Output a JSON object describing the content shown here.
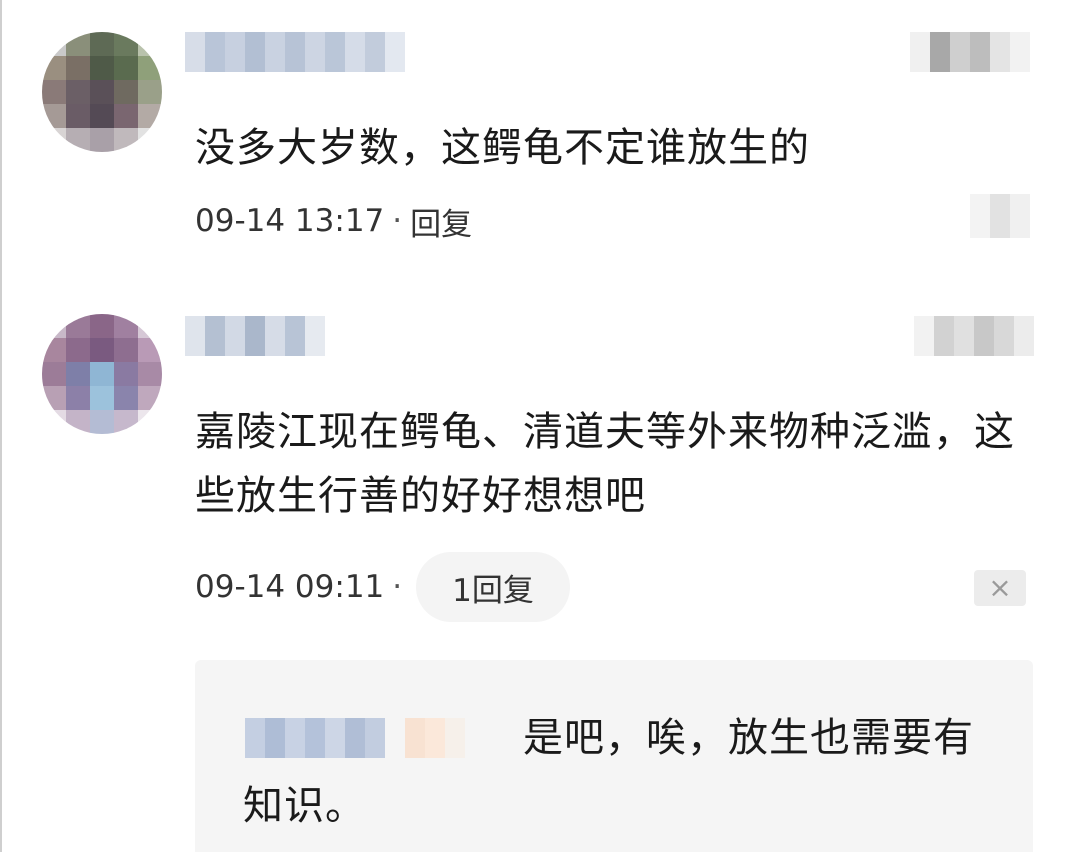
{
  "comments": [
    {
      "text": "没多大岁数，这鳄龟不定谁放生的",
      "timestamp": "09-14 13:17",
      "separator": "·",
      "reply_label": "回复"
    },
    {
      "text": "嘉陵江现在鳄龟、清道夫等外来物种泛滥，这些放生行善的好好想想吧",
      "timestamp": "09-14 09:11",
      "separator": "·",
      "reply_label": "1回复",
      "close_icon": "×",
      "sub_reply": {
        "text": "是吧，唉，放生也需要有知识。"
      }
    }
  ],
  "colors": {
    "text": "#1a1a1a",
    "meta": "#333333",
    "pill_bg": "#f4f4f4",
    "sub_reply_bg": "#f5f5f5"
  }
}
